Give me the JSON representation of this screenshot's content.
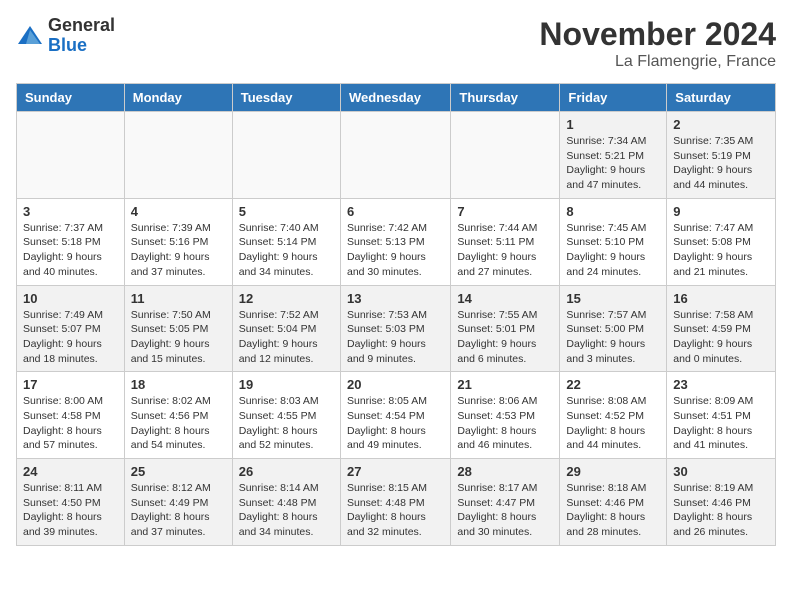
{
  "logo": {
    "general": "General",
    "blue": "Blue"
  },
  "title": "November 2024",
  "location": "La Flamengrie, France",
  "days_header": [
    "Sunday",
    "Monday",
    "Tuesday",
    "Wednesday",
    "Thursday",
    "Friday",
    "Saturday"
  ],
  "weeks": [
    [
      {
        "day": "",
        "info": ""
      },
      {
        "day": "",
        "info": ""
      },
      {
        "day": "",
        "info": ""
      },
      {
        "day": "",
        "info": ""
      },
      {
        "day": "",
        "info": ""
      },
      {
        "day": "1",
        "info": "Sunrise: 7:34 AM\nSunset: 5:21 PM\nDaylight: 9 hours and 47 minutes."
      },
      {
        "day": "2",
        "info": "Sunrise: 7:35 AM\nSunset: 5:19 PM\nDaylight: 9 hours and 44 minutes."
      }
    ],
    [
      {
        "day": "3",
        "info": "Sunrise: 7:37 AM\nSunset: 5:18 PM\nDaylight: 9 hours and 40 minutes."
      },
      {
        "day": "4",
        "info": "Sunrise: 7:39 AM\nSunset: 5:16 PM\nDaylight: 9 hours and 37 minutes."
      },
      {
        "day": "5",
        "info": "Sunrise: 7:40 AM\nSunset: 5:14 PM\nDaylight: 9 hours and 34 minutes."
      },
      {
        "day": "6",
        "info": "Sunrise: 7:42 AM\nSunset: 5:13 PM\nDaylight: 9 hours and 30 minutes."
      },
      {
        "day": "7",
        "info": "Sunrise: 7:44 AM\nSunset: 5:11 PM\nDaylight: 9 hours and 27 minutes."
      },
      {
        "day": "8",
        "info": "Sunrise: 7:45 AM\nSunset: 5:10 PM\nDaylight: 9 hours and 24 minutes."
      },
      {
        "day": "9",
        "info": "Sunrise: 7:47 AM\nSunset: 5:08 PM\nDaylight: 9 hours and 21 minutes."
      }
    ],
    [
      {
        "day": "10",
        "info": "Sunrise: 7:49 AM\nSunset: 5:07 PM\nDaylight: 9 hours and 18 minutes."
      },
      {
        "day": "11",
        "info": "Sunrise: 7:50 AM\nSunset: 5:05 PM\nDaylight: 9 hours and 15 minutes."
      },
      {
        "day": "12",
        "info": "Sunrise: 7:52 AM\nSunset: 5:04 PM\nDaylight: 9 hours and 12 minutes."
      },
      {
        "day": "13",
        "info": "Sunrise: 7:53 AM\nSunset: 5:03 PM\nDaylight: 9 hours and 9 minutes."
      },
      {
        "day": "14",
        "info": "Sunrise: 7:55 AM\nSunset: 5:01 PM\nDaylight: 9 hours and 6 minutes."
      },
      {
        "day": "15",
        "info": "Sunrise: 7:57 AM\nSunset: 5:00 PM\nDaylight: 9 hours and 3 minutes."
      },
      {
        "day": "16",
        "info": "Sunrise: 7:58 AM\nSunset: 4:59 PM\nDaylight: 9 hours and 0 minutes."
      }
    ],
    [
      {
        "day": "17",
        "info": "Sunrise: 8:00 AM\nSunset: 4:58 PM\nDaylight: 8 hours and 57 minutes."
      },
      {
        "day": "18",
        "info": "Sunrise: 8:02 AM\nSunset: 4:56 PM\nDaylight: 8 hours and 54 minutes."
      },
      {
        "day": "19",
        "info": "Sunrise: 8:03 AM\nSunset: 4:55 PM\nDaylight: 8 hours and 52 minutes."
      },
      {
        "day": "20",
        "info": "Sunrise: 8:05 AM\nSunset: 4:54 PM\nDaylight: 8 hours and 49 minutes."
      },
      {
        "day": "21",
        "info": "Sunrise: 8:06 AM\nSunset: 4:53 PM\nDaylight: 8 hours and 46 minutes."
      },
      {
        "day": "22",
        "info": "Sunrise: 8:08 AM\nSunset: 4:52 PM\nDaylight: 8 hours and 44 minutes."
      },
      {
        "day": "23",
        "info": "Sunrise: 8:09 AM\nSunset: 4:51 PM\nDaylight: 8 hours and 41 minutes."
      }
    ],
    [
      {
        "day": "24",
        "info": "Sunrise: 8:11 AM\nSunset: 4:50 PM\nDaylight: 8 hours and 39 minutes."
      },
      {
        "day": "25",
        "info": "Sunrise: 8:12 AM\nSunset: 4:49 PM\nDaylight: 8 hours and 37 minutes."
      },
      {
        "day": "26",
        "info": "Sunrise: 8:14 AM\nSunset: 4:48 PM\nDaylight: 8 hours and 34 minutes."
      },
      {
        "day": "27",
        "info": "Sunrise: 8:15 AM\nSunset: 4:48 PM\nDaylight: 8 hours and 32 minutes."
      },
      {
        "day": "28",
        "info": "Sunrise: 8:17 AM\nSunset: 4:47 PM\nDaylight: 8 hours and 30 minutes."
      },
      {
        "day": "29",
        "info": "Sunrise: 8:18 AM\nSunset: 4:46 PM\nDaylight: 8 hours and 28 minutes."
      },
      {
        "day": "30",
        "info": "Sunrise: 8:19 AM\nSunset: 4:46 PM\nDaylight: 8 hours and 26 minutes."
      }
    ]
  ]
}
